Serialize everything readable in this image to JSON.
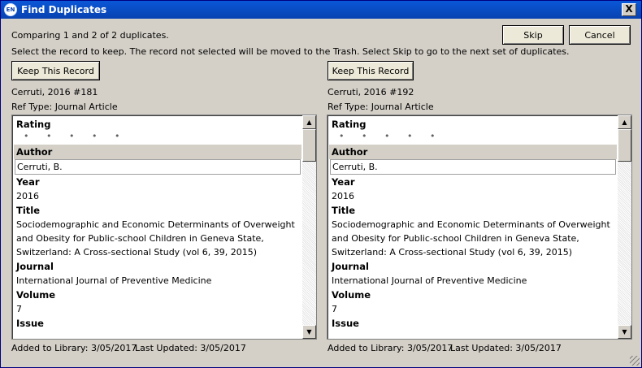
{
  "window": {
    "title": "Find Duplicates",
    "icon": "EN",
    "close_label": "X"
  },
  "status": {
    "comparing": "Comparing 1 and 2 of 2 duplicates.",
    "instruction": "Select the record to keep. The record not selected will be moved to the Trash. Select Skip to go to the next set of duplicates."
  },
  "buttons": {
    "skip": "Skip",
    "cancel": "Cancel"
  },
  "records": [
    {
      "keep_label": "Keep This Record",
      "citation": "Cerruti, 2016 #181",
      "ref_type": "Ref Type: Journal Article",
      "fields": {
        "rating_label": "Rating",
        "rating_value": "•  •  •  •  •",
        "author_label": "Author",
        "author_value": "Cerruti, B.",
        "year_label": "Year",
        "year_value": "2016",
        "title_label": "Title",
        "title_line1": "Sociodemographic and Economic Determinants of Overweight",
        "title_line2": "and Obesity for Public-school Children in Geneva State,",
        "title_line3": "Switzerland: A Cross-sectional Study (vol 6, 39, 2015)",
        "journal_label": "Journal",
        "journal_value": "International Journal of Preventive Medicine",
        "volume_label": "Volume",
        "volume_value": "7",
        "issue_label": "Issue"
      },
      "added": "Added to Library: 3/05/2017",
      "updated": "Last Updated: 3/05/2017"
    },
    {
      "keep_label": "Keep This Record",
      "citation": "Cerruti, 2016 #192",
      "ref_type": "Ref Type: Journal Article",
      "fields": {
        "rating_label": "Rating",
        "rating_value": "•  •  •  •  •",
        "author_label": "Author",
        "author_value": "Cerruti, B.",
        "year_label": "Year",
        "year_value": "2016",
        "title_label": "Title",
        "title_line1": "Sociodemographic and Economic Determinants of Overweight",
        "title_line2": "and Obesity for Public-school Children in Geneva State,",
        "title_line3": "Switzerland: A Cross-sectional Study (vol 6, 39, 2015)",
        "journal_label": "Journal",
        "journal_value": "International Journal of Preventive Medicine",
        "volume_label": "Volume",
        "volume_value": "7",
        "issue_label": "Issue"
      },
      "added": "Added to Library: 3/05/2017",
      "updated": "Last Updated: 3/05/2017"
    }
  ]
}
